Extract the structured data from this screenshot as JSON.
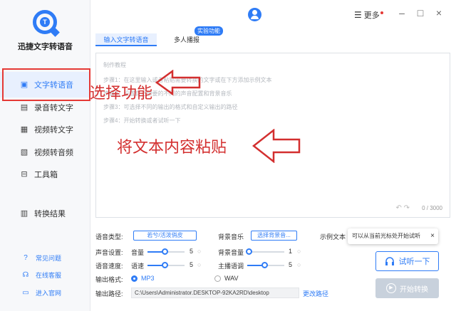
{
  "app": {
    "name": "迅捷文字转语音",
    "logo_letter": "T"
  },
  "sidebar": {
    "items": [
      {
        "label": "文字转语音",
        "icon": "text-to-speech-icon"
      },
      {
        "label": "录音转文字",
        "icon": "record-to-text-icon"
      },
      {
        "label": "视频转文字",
        "icon": "video-to-text-icon"
      },
      {
        "label": "视频转音频",
        "icon": "video-to-audio-icon"
      },
      {
        "label": "工具箱",
        "icon": "toolbox-icon"
      },
      {
        "label": "转换结果",
        "icon": "result-icon"
      }
    ],
    "footer": [
      {
        "label": "常见问题",
        "icon": "question-icon"
      },
      {
        "label": "在线客服",
        "icon": "headset-icon"
      },
      {
        "label": "进入官网",
        "icon": "website-icon"
      }
    ]
  },
  "header": {
    "more_label": "更多"
  },
  "tabs": [
    {
      "label": "输入文字转语音"
    },
    {
      "label": "多人播报"
    }
  ],
  "lab_tag": "实验功能",
  "editor": {
    "lines": [
      "制作教程",
      "步骤1：在这里输入或者粘贴需要转换的文字或在下方添加示例文本",
      "步骤2：设置自己想要的不同的声音配置和背景音乐",
      "步骤3：可选择不同的输出的格式和自定义输出的路径",
      "步骤4：开始转换或者试听一下"
    ],
    "counter": "0 / 3000"
  },
  "annotations": {
    "select_function": "选择功能",
    "paste_text": "将文本内容粘贴"
  },
  "settings": {
    "voice_type_label": "语音类型:",
    "voice_type_value": "若兮/活泼俏皮",
    "bg_music_label": "背景音乐",
    "bg_music_button": "选择背景音...",
    "sample_text_label": "示例文本",
    "voice_setting_label": "声音设置:",
    "volume_label": "音量",
    "volume_value": "5",
    "bg_volume_label": "背景音量",
    "bg_volume_value": "1",
    "speed_label": "语音速度:",
    "speed_sub_label": "语速",
    "speed_value": "5",
    "tone_label": "主播语调",
    "tone_value": "5",
    "format_label": "输出格式:",
    "format_mp3": "MP3",
    "format_wav": "WAV",
    "path_label": "输出路径:",
    "path_value": "C:\\Users\\Administrator.DESKTOP-92KA2RD\\desktop",
    "change_path": "更改路径"
  },
  "tooltip": "可以从当前光标处开始试听",
  "buttons": {
    "listen": "试听一下",
    "start": "开始转换"
  },
  "colors": {
    "accent": "#2f7cf6",
    "annotation": "#d32f2f"
  }
}
